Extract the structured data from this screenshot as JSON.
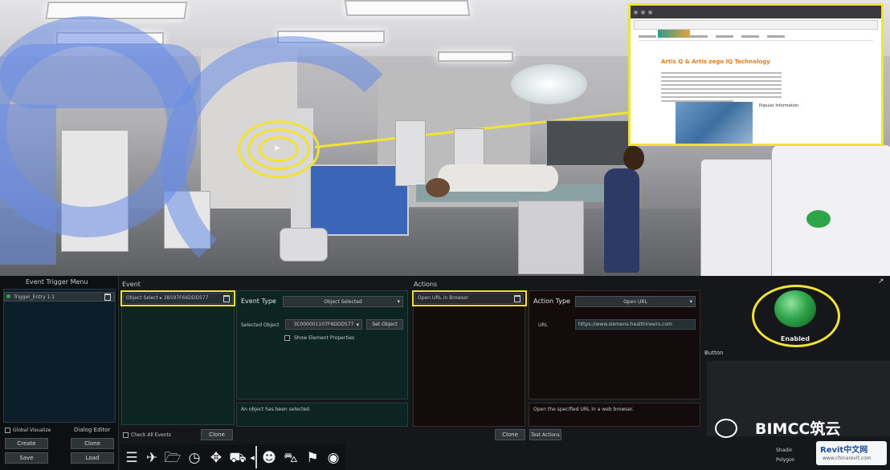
{
  "event_trigger_menu": {
    "title": "Event Trigger Menu",
    "trigger_item": "Trigger_Entry 1.1",
    "global_visualize_label": "Global Visualize",
    "dialog_editor_label": "Dialog Editor",
    "buttons": {
      "create": "Create",
      "clone": "Clone",
      "save": "Save",
      "load": "Load"
    }
  },
  "event": {
    "section_title": "Event",
    "selected_event": "Object Select ▸ 3B597F66DDD577",
    "event_type_label": "Event Type",
    "event_type_value": "Object Selected",
    "selected_object_label": "Selected Object",
    "selected_object_value": "3C000001107F6DDD577",
    "set_object_button": "Set Object",
    "show_element_properties": "Show Element Properties",
    "description": "An object has been selected.",
    "check_all_events": "Check All Events",
    "clone_button": "Clone"
  },
  "actions": {
    "section_title": "Actions",
    "selected_action": "Open URL in Browser",
    "action_type_label": "Action Type",
    "action_type_value": "Open URL",
    "url_label": "URL",
    "url_value": "https://www.siemens-healthineers.com",
    "description": "Open the specified URL in a web browser.",
    "clone_button": "Clone",
    "test_actions_button": "Test Actions"
  },
  "right_panel": {
    "button_status": "Enabled",
    "section_label": "Button",
    "shading_label": "Shadin",
    "polygon_label": "Polygon"
  },
  "toolbar_icons": [
    "list-icon",
    "plane-icon",
    "folder-icon",
    "clock-icon",
    "move-icon",
    "vehicle-icon",
    "chevron-left-icon",
    "person-icon",
    "car-icon",
    "sign-icon",
    "eye-icon"
  ],
  "watermark": {
    "brand": "BIMCC筑云",
    "logo_text": "Revit中文网",
    "logo_url": "www.chinarevit.com"
  },
  "browser_popup": {
    "heading": "Artis Q & Artis zego IQ Technology",
    "side_heading": "Popular Information"
  },
  "colors": {
    "highlight": "#f2e233",
    "panel_bg": "#101214",
    "field_bg": "#0c2422",
    "enabled_green": "#2fa54a",
    "carm_blue": "#698ce6"
  }
}
